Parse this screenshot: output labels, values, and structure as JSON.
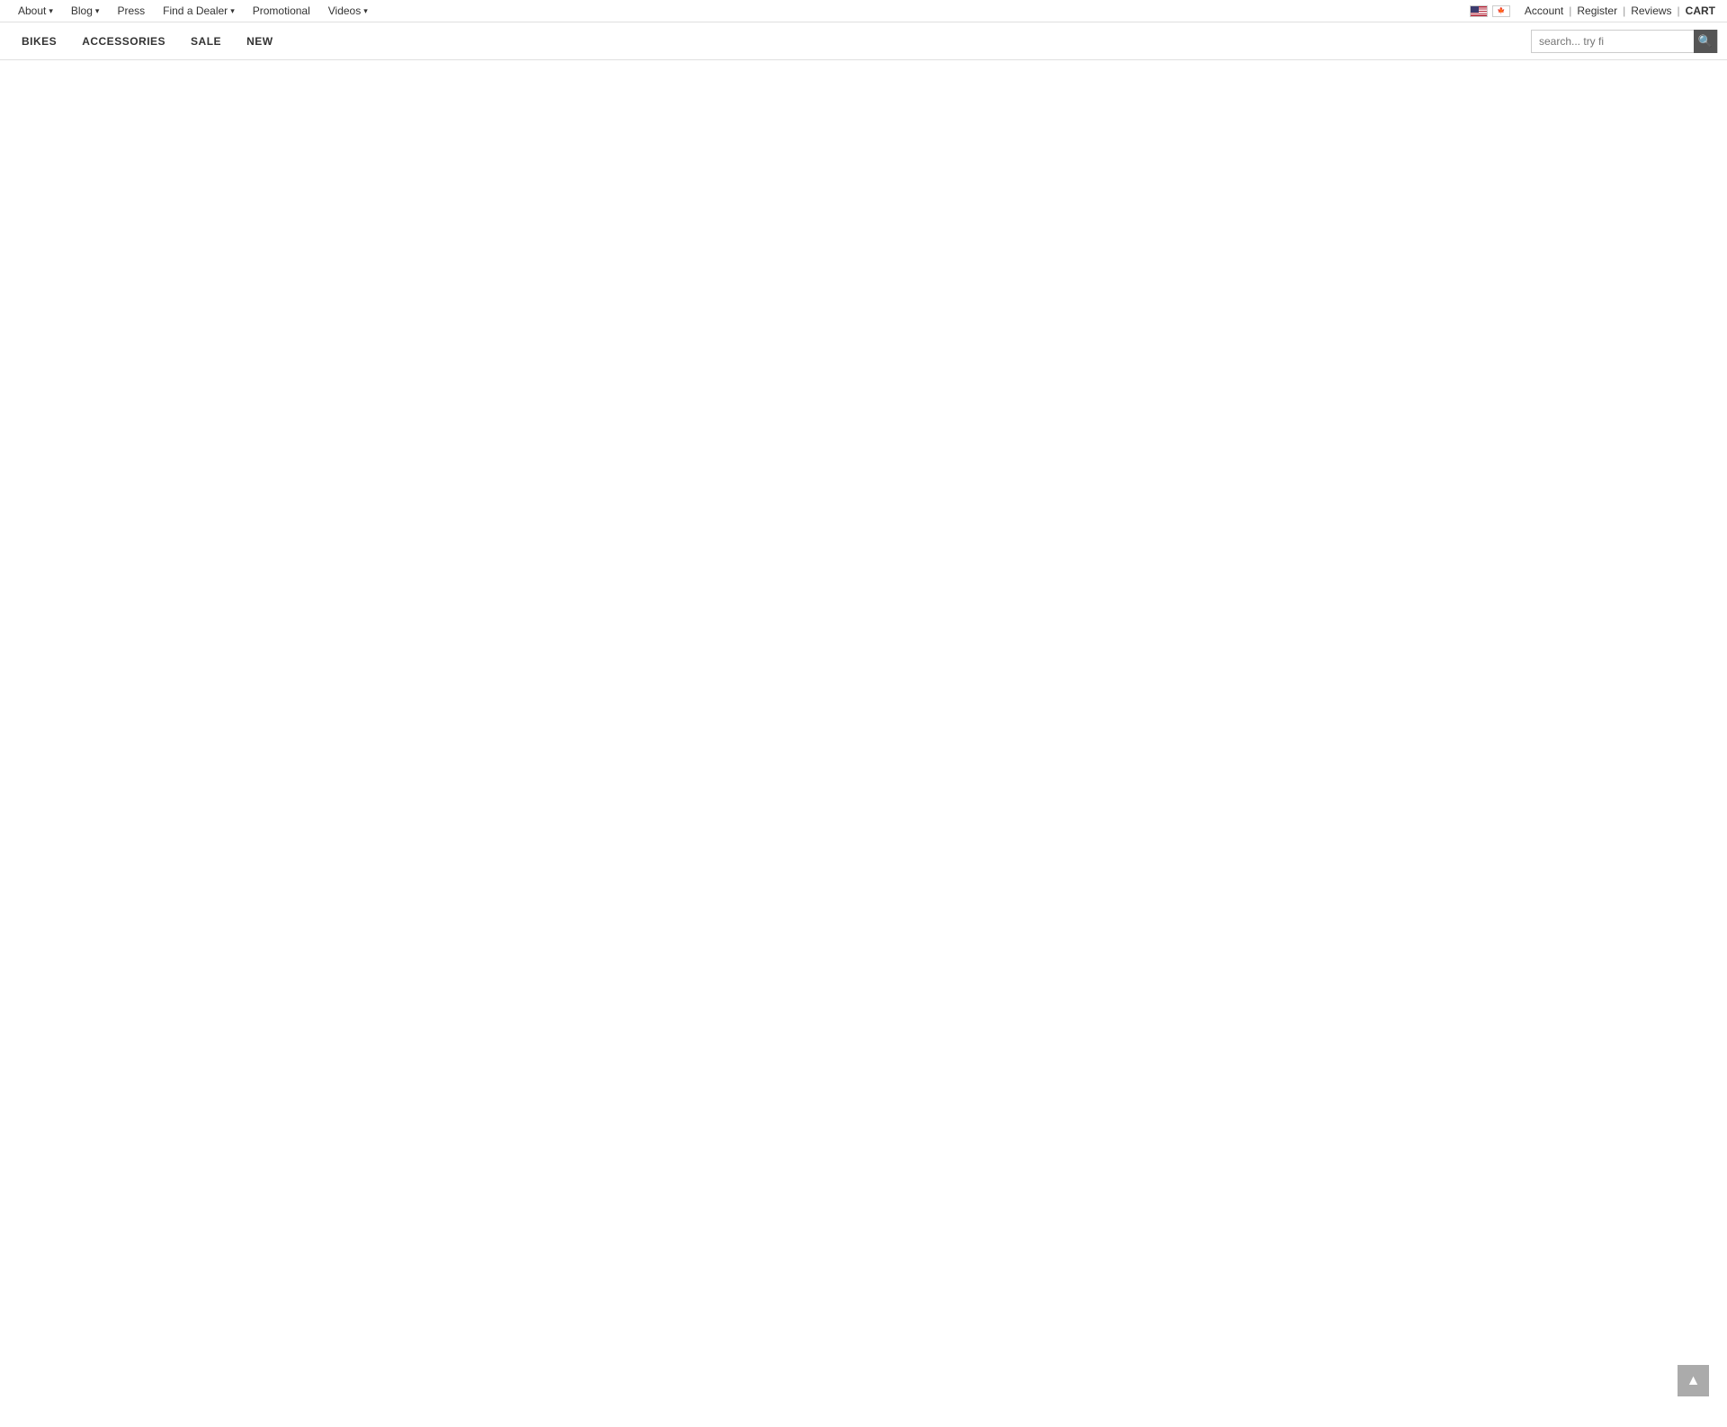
{
  "topBar": {
    "leftItems": [
      {
        "label": "About",
        "hasDropdown": true,
        "name": "about"
      },
      {
        "label": "Blog",
        "hasDropdown": true,
        "name": "blog"
      },
      {
        "label": "Press",
        "hasDropdown": false,
        "name": "press"
      },
      {
        "label": "Find a Dealer",
        "hasDropdown": true,
        "name": "find-a-dealer"
      },
      {
        "label": "Promotional",
        "hasDropdown": false,
        "name": "promotional"
      },
      {
        "label": "Videos",
        "hasDropdown": true,
        "name": "videos"
      }
    ],
    "authLinks": {
      "account": "Account",
      "separator1": "|",
      "register": "Register",
      "separator2": "|",
      "reviews": "Reviews",
      "separator3": "|",
      "cart": "CART"
    }
  },
  "mainNav": {
    "items": [
      {
        "label": "BIKES",
        "name": "bikes"
      },
      {
        "label": "ACCESSORIES",
        "name": "accessories"
      },
      {
        "label": "SALE",
        "name": "sale"
      },
      {
        "label": "NEW",
        "name": "new"
      }
    ],
    "search": {
      "placeholder": "search... try fi",
      "buttonLabel": "🔍"
    }
  },
  "icons": {
    "search": "🔍",
    "chevronDown": "▾",
    "backToTop": "▲"
  }
}
